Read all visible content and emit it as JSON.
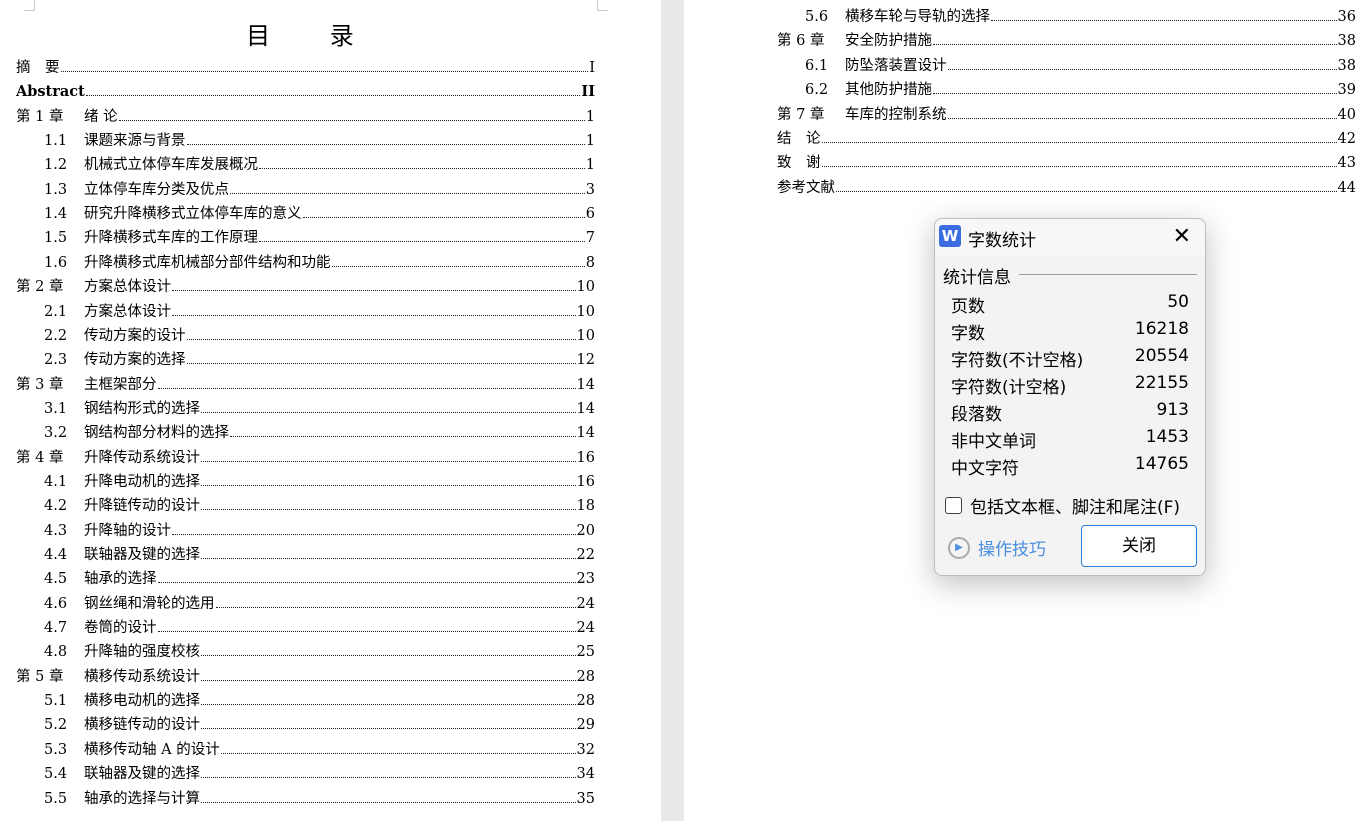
{
  "toc_title": "目 录",
  "left_entries": [
    {
      "num": "摘　要",
      "title": "",
      "page": "I",
      "level": 0
    },
    {
      "num": "Abstract",
      "title": "",
      "page": "II",
      "level": 0,
      "bold": true
    },
    {
      "num": "第 1 章",
      "title": "绪 论",
      "page": "1",
      "level": 1
    },
    {
      "num": "1.1",
      "title": "课题来源与背景",
      "page": "1",
      "level": 2
    },
    {
      "num": "1.2",
      "title": "机械式立体停车库发展概况",
      "page": "1",
      "level": 2
    },
    {
      "num": "1.3",
      "title": "立体停车库分类及优点",
      "page": "3",
      "level": 2
    },
    {
      "num": "1.4",
      "title": "研究升降横移式立体停车库的意义",
      "page": "6",
      "level": 2
    },
    {
      "num": "1.5",
      "title": "升降横移式车库的工作原理",
      "page": "7",
      "level": 2
    },
    {
      "num": "1.6",
      "title": "升降横移式库机械部分部件结构和功能",
      "page": "8",
      "level": 2
    },
    {
      "num": "第 2 章",
      "title": "方案总体设计",
      "page": "10",
      "level": 1
    },
    {
      "num": "2.1",
      "title": "方案总体设计",
      "page": "10",
      "level": 2
    },
    {
      "num": "2.2",
      "title": "传动方案的设计",
      "page": "10",
      "level": 2
    },
    {
      "num": "2.3",
      "title": "传动方案的选择",
      "page": "12",
      "level": 2
    },
    {
      "num": "第 3 章",
      "title": "主框架部分",
      "page": "14",
      "level": 1
    },
    {
      "num": "3.1",
      "title": "钢结构形式的选择",
      "page": "14",
      "level": 2
    },
    {
      "num": "3.2",
      "title": "钢结构部分材料的选择",
      "page": "14",
      "level": 2
    },
    {
      "num": "第 4 章",
      "title": "升降传动系统设计",
      "page": "16",
      "level": 1
    },
    {
      "num": "4.1",
      "title": "升降电动机的选择",
      "page": "16",
      "level": 2
    },
    {
      "num": "4.2",
      "title": "升降链传动的设计",
      "page": "18",
      "level": 2
    },
    {
      "num": "4.3",
      "title": "升降轴的设计",
      "page": "20",
      "level": 2
    },
    {
      "num": "4.4",
      "title": "联轴器及键的选择",
      "page": "22",
      "level": 2
    },
    {
      "num": "4.5",
      "title": "轴承的选择",
      "page": "23",
      "level": 2
    },
    {
      "num": "4.6",
      "title": "钢丝绳和滑轮的选用",
      "page": "24",
      "level": 2
    },
    {
      "num": "4.7",
      "title": "卷筒的设计",
      "page": "24",
      "level": 2
    },
    {
      "num": "4.8",
      "title": "升降轴的强度校核",
      "page": "25",
      "level": 2
    },
    {
      "num": "第 5 章",
      "title": "横移传动系统设计",
      "page": "28",
      "level": 1
    },
    {
      "num": "5.1",
      "title": "横移电动机的选择",
      "page": "28",
      "level": 2
    },
    {
      "num": "5.2",
      "title": "横移链传动的设计",
      "page": "29",
      "level": 2
    },
    {
      "num": "5.3",
      "title": "横移传动轴 A 的设计",
      "page": "32",
      "level": 2
    },
    {
      "num": "5.4",
      "title": "联轴器及键的选择",
      "page": "34",
      "level": 2
    },
    {
      "num": "5.5",
      "title": "轴承的选择与计算",
      "page": "35",
      "level": 2
    }
  ],
  "right_entries": [
    {
      "num": "5.6",
      "title": "横移车轮与导轨的选择",
      "page": "36",
      "level": 2
    },
    {
      "num": "第 6 章",
      "title": "安全防护措施",
      "page": "38",
      "level": 1
    },
    {
      "num": "6.1",
      "title": "防坠落装置设计",
      "page": "38",
      "level": 2
    },
    {
      "num": "6.2",
      "title": "其他防护措施",
      "page": "39",
      "level": 2
    },
    {
      "num": "第 7 章",
      "title": "车库的控制系统",
      "page": "40",
      "level": 1
    },
    {
      "num": "结　论",
      "title": "",
      "page": "42",
      "level": 0
    },
    {
      "num": "致　谢",
      "title": "",
      "page": "43",
      "level": 0
    },
    {
      "num": "参考文献",
      "title": "",
      "page": "44",
      "level": 0
    }
  ],
  "dialog": {
    "icon_letter": "W",
    "title": "字数统计",
    "section": "统计信息",
    "stats": [
      {
        "label": "页数",
        "value": "50"
      },
      {
        "label": "字数",
        "value": "16218"
      },
      {
        "label": "字符数(不计空格)",
        "value": "20554"
      },
      {
        "label": "字符数(计空格)",
        "value": "22155"
      },
      {
        "label": "段落数",
        "value": "913"
      },
      {
        "label": "非中文单词",
        "value": "1453"
      },
      {
        "label": "中文字符",
        "value": "14765"
      }
    ],
    "checkbox_label": "包括文本框、脚注和尾注(F)",
    "checkbox_checked": false,
    "tips_label": "操作技巧",
    "close_label": "关闭",
    "accent": "#2b7cd3"
  }
}
